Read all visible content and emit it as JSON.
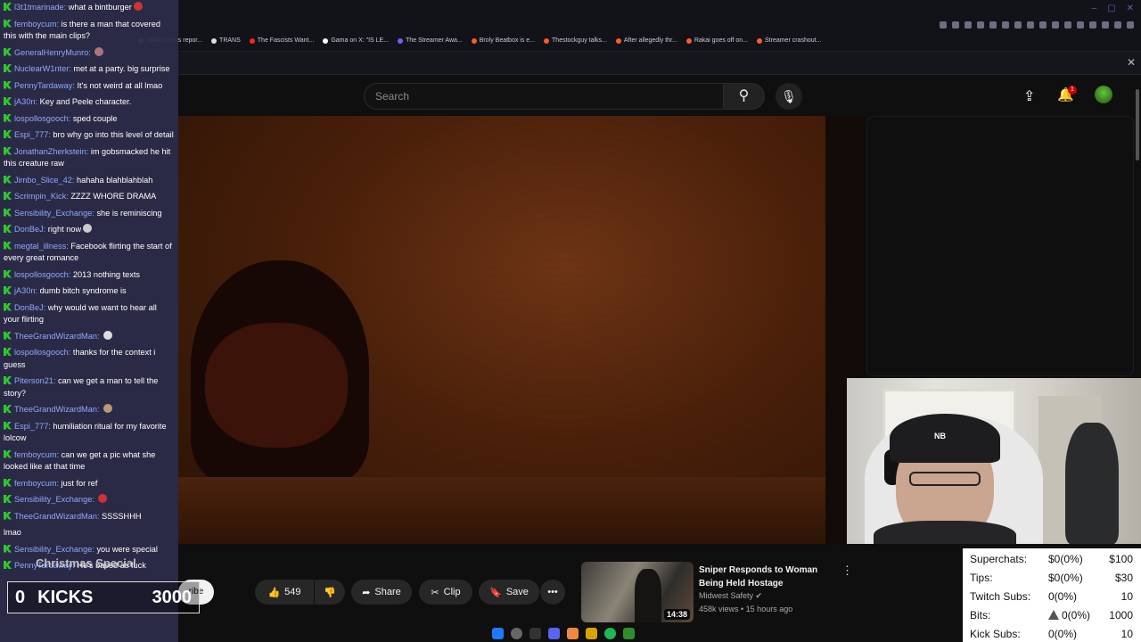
{
  "search": {
    "placeholder": "Search"
  },
  "header": {
    "notification_count": "1"
  },
  "video_actions": {
    "subscribe_fragment": "ribe",
    "like_count": "549",
    "share_label": "Share",
    "clip_label": "Clip",
    "save_label": "Save"
  },
  "recommendation": {
    "title": "Sniper Responds to Woman Being Held Hostage",
    "channel": "Midwest Safety",
    "meta": "458k views • 15 hours ago",
    "duration": "14:38"
  },
  "bookmarks": [
    {
      "label": "India Love is repor...",
      "color": "#888888"
    },
    {
      "label": "TRANS",
      "color": "#dddddd"
    },
    {
      "label": "The Fascists Want...",
      "color": "#ff2222"
    },
    {
      "label": "Gama on X: \"IS LE...",
      "color": "#ffffff"
    },
    {
      "label": "The Streamer Awa...",
      "color": "#7a5cff"
    },
    {
      "label": "Broly Beatbox is e...",
      "color": "#ff5a2a"
    },
    {
      "label": "Thestockguy talks...",
      "color": "#ff5a2a"
    },
    {
      "label": "After allegedly thr...",
      "color": "#ff5a2a"
    },
    {
      "label": "Rakai goes off on...",
      "color": "#ff5a2a"
    },
    {
      "label": "Streamer crashout...",
      "color": "#ff5a2a"
    }
  ],
  "chat": [
    {
      "user": "l3t1tmarinade",
      "text": "what a bintburger",
      "emote": "#c33"
    },
    {
      "user": "femboycum",
      "text": "is there a man that covered this with the main clips?",
      "emote": ""
    },
    {
      "user": "GeneralHenryMunro",
      "text": "",
      "emote": "#a77"
    },
    {
      "user": "NuclearW1nter",
      "text": "met at a party. big surprise",
      "emote": ""
    },
    {
      "user": "PennyTardaway",
      "text": "It's not weird at all lmao",
      "emote": ""
    },
    {
      "user": "jA30n",
      "text": "Key and Peele character.",
      "emote": ""
    },
    {
      "user": "lospollosgooch",
      "text": "sped couple",
      "emote": ""
    },
    {
      "user": "Espi_777",
      "text": "bro why go into this level of detail",
      "emote": ""
    },
    {
      "user": "JonathanZherkstein",
      "text": "im gobsmacked he hit this creature raw",
      "emote": ""
    },
    {
      "user": "Jimbo_Slice_42",
      "text": "hahaha blahblahblah",
      "emote": ""
    },
    {
      "user": "Scrimpin_Kick",
      "text": "ZZZZ WHORE DRAMA",
      "emote": ""
    },
    {
      "user": "Sensibility_Exchange",
      "text": "she is reminiscing",
      "emote": ""
    },
    {
      "user": "DonBeJ",
      "text": "right now",
      "emote": "#ccc"
    },
    {
      "user": "megtal_illness",
      "text": "Facebook flirting the start of every great romance",
      "emote": ""
    },
    {
      "user": "lospollosgooch",
      "text": "2013 nothing texts",
      "emote": ""
    },
    {
      "user": "jA30n",
      "text": "dumb bitch syndrome is",
      "emote": ""
    },
    {
      "user": "DonBeJ",
      "text": "why would we want to hear all your flirting",
      "emote": ""
    },
    {
      "user": "TheeGrandWizardMan",
      "text": "",
      "emote": "#ddd"
    },
    {
      "user": "lospollosgooch",
      "text": "thanks for the context i guess",
      "emote": ""
    },
    {
      "user": "Piterson21",
      "text": "can we get a man to tell the story?",
      "emote": ""
    },
    {
      "user": "TheeGrandWizardMan",
      "text": "",
      "emote": "#b97"
    },
    {
      "user": "Espi_777",
      "text": "humiliation ritual for my favorite lolcow",
      "emote": ""
    },
    {
      "user": "femboycum",
      "text": "can we get a pic what she looked like at that time",
      "emote": ""
    },
    {
      "user": "femboycum",
      "text": "just for ref",
      "emote": ""
    },
    {
      "user": "Sensibility_Exchange",
      "text": "",
      "emote": "#c33"
    },
    {
      "user": "TheeGrandWizardMan",
      "text": "SSSSHHH",
      "emote": ""
    },
    {
      "user": "",
      "text": "lmao",
      "emote": ""
    },
    {
      "user": "Sensibility_Exchange",
      "text": "you were special",
      "emote": ""
    },
    {
      "user": "PennyTardaway",
      "text": "He's based as fuck",
      "emote": ""
    }
  ],
  "overlay": {
    "christmas_label": "Christmas Special",
    "kicks_count": "0",
    "kicks_label": "KICKS",
    "kicks_goal": "3000"
  },
  "stats": [
    {
      "label": "Superchats:",
      "value": "$0(0%)",
      "goal": "$100",
      "warn": false
    },
    {
      "label": "Tips:",
      "value": "$0(0%)",
      "goal": "$30",
      "warn": false
    },
    {
      "label": "Twitch Subs:",
      "value": "0(0%)",
      "goal": "10",
      "warn": false
    },
    {
      "label": "Bits:",
      "value": "0(0%)",
      "goal": "1000",
      "warn": true
    },
    {
      "label": "Kick Subs:",
      "value": "0(0%)",
      "goal": "10",
      "warn": false
    }
  ],
  "colors": {
    "chat_bg": "#2c2c4a",
    "username": "#8fa8ff",
    "kick_badge": "#2bc92b",
    "notification": "#cc0000"
  }
}
